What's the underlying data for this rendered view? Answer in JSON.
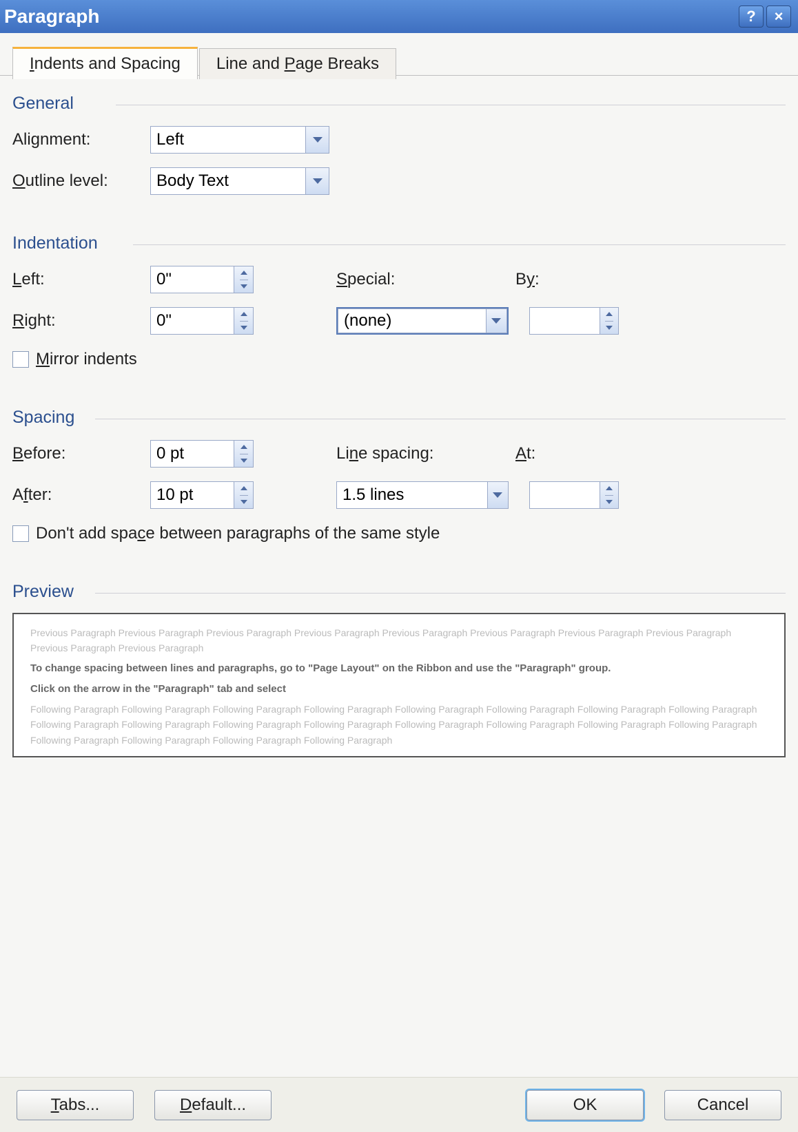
{
  "title": "Paragraph",
  "tabs": {
    "indents": "Indents and Spacing",
    "breaks": "Line and Page Breaks"
  },
  "groups": {
    "general": "General",
    "indentation": "Indentation",
    "spacing": "Spacing",
    "preview": "Preview"
  },
  "general": {
    "alignment_label": "Alignment:",
    "alignment_value": "Left",
    "outline_label": "Outline level:",
    "outline_value": "Body Text"
  },
  "indentation": {
    "left_label": "Left:",
    "left_value": "0\"",
    "right_label": "Right:",
    "right_value": "0\"",
    "special_label": "Special:",
    "special_value": "(none)",
    "by_label": "By:",
    "by_value": "",
    "mirror_label": "Mirror indents"
  },
  "spacing": {
    "before_label": "Before:",
    "before_value": "0 pt",
    "after_label": "After:",
    "after_value": "10 pt",
    "line_label": "Line spacing:",
    "line_value": "1.5 lines",
    "at_label": "At:",
    "at_value": "",
    "noadd_label": "Don't add space between paragraphs of the same style"
  },
  "preview": {
    "prev_text": "Previous Paragraph Previous Paragraph Previous Paragraph Previous Paragraph Previous Paragraph Previous Paragraph Previous Paragraph Previous Paragraph Previous Paragraph Previous Paragraph",
    "sample_line1": "To change spacing between lines and paragraphs, go to \"Page Layout\" on the Ribbon and use the \"Paragraph\" group.",
    "sample_line2": "Click on the arrow in the \"Paragraph\" tab and select",
    "next_text": "Following Paragraph Following Paragraph Following Paragraph Following Paragraph Following Paragraph Following Paragraph Following Paragraph Following Paragraph Following Paragraph Following Paragraph Following Paragraph Following Paragraph Following Paragraph Following Paragraph Following Paragraph Following Paragraph Following Paragraph Following Paragraph Following Paragraph Following Paragraph"
  },
  "buttons": {
    "tabs": "Tabs...",
    "default": "Default...",
    "ok": "OK",
    "cancel": "Cancel"
  }
}
